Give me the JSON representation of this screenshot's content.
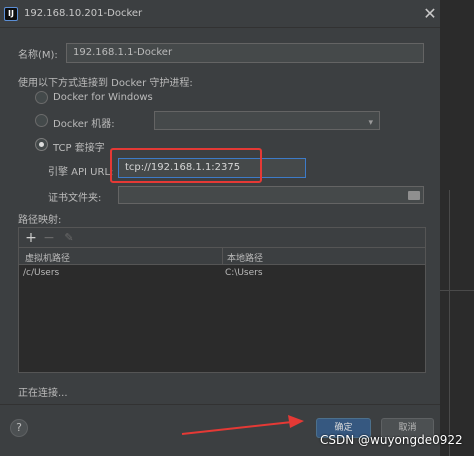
{
  "window": {
    "title": "192.168.10.201-Docker",
    "app_icon_glyph": "IJ",
    "close_glyph": "✕"
  },
  "form": {
    "name_label": "名称(M):",
    "name_value": "192.168.1.1-Docker",
    "connect_label": "使用以下方式连接到 Docker 守护进程:",
    "options": {
      "docker_for_windows": "Docker for Windows",
      "docker_machine": "Docker 机器:",
      "tcp_socket": "TCP 套接字"
    },
    "selected_option": "tcp_socket",
    "docker_machine_value": "",
    "engine_api_label": "引擎 API URL:",
    "engine_api_value": "tcp://192.168.1.1:2375",
    "cert_folder_label": "证书文件夹:",
    "cert_folder_value": ""
  },
  "path_mappings": {
    "label": "路径映射:",
    "toolbar": {
      "add": "+",
      "remove": "−",
      "edit": "✎"
    },
    "columns": [
      "虚拟机路径",
      "本地路径"
    ],
    "rows": [
      {
        "vm_path": "/c/Users",
        "local_path": "C:\\Users"
      }
    ]
  },
  "status": {
    "text": "正在连接..."
  },
  "footer": {
    "help": "?",
    "ok_label": "确定",
    "cancel_label": "取消"
  },
  "watermark": "CSDN @wuyongde0922",
  "icons": {
    "select_arrow": "▾",
    "folder": "folder-icon"
  },
  "colors": {
    "background": "#3c3f41",
    "input_background": "#45494a",
    "accent_blue": "#365880",
    "highlight_red": "#e53935"
  }
}
